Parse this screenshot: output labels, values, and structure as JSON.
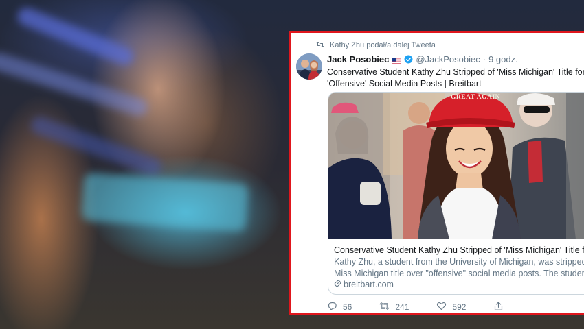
{
  "colors": {
    "frame_border": "#e0161d",
    "text_primary": "#14171a",
    "text_secondary": "#657786",
    "verified_blue": "#1da1f2",
    "cap_red": "#d6202a"
  },
  "tweet": {
    "retweet_context": "Kathy Zhu podał/a dalej Tweeta",
    "author_name": "Jack Posobiec",
    "author_handle": "@JackPosobiec",
    "time_separator": "·",
    "timestamp": "9 godz.",
    "text": "Conservative Student Kathy Zhu Stripped of 'Miss Michigan' Title for 'Offensive' Social Media Posts | Breitbart",
    "link_card": {
      "image_caption_text": "GREAT AGAIN",
      "title": "Conservative Student Kathy Zhu Stripped of 'Miss Michigan' Title for 'Offensive' Social Media Posts",
      "description_line1": "Kathy Zhu, a student from the University of Michigan, was stripped of her",
      "description_line2": "Miss Michigan title over \"offensive\" social media posts. The student said",
      "domain": "breitbart.com"
    },
    "actions": {
      "replies": "56",
      "retweets": "241",
      "likes": "592"
    },
    "icons": [
      "retweet-icon",
      "us-flag-icon",
      "verified-badge-icon",
      "link-icon",
      "reply-icon",
      "retweet-icon",
      "like-icon",
      "share-icon"
    ]
  }
}
